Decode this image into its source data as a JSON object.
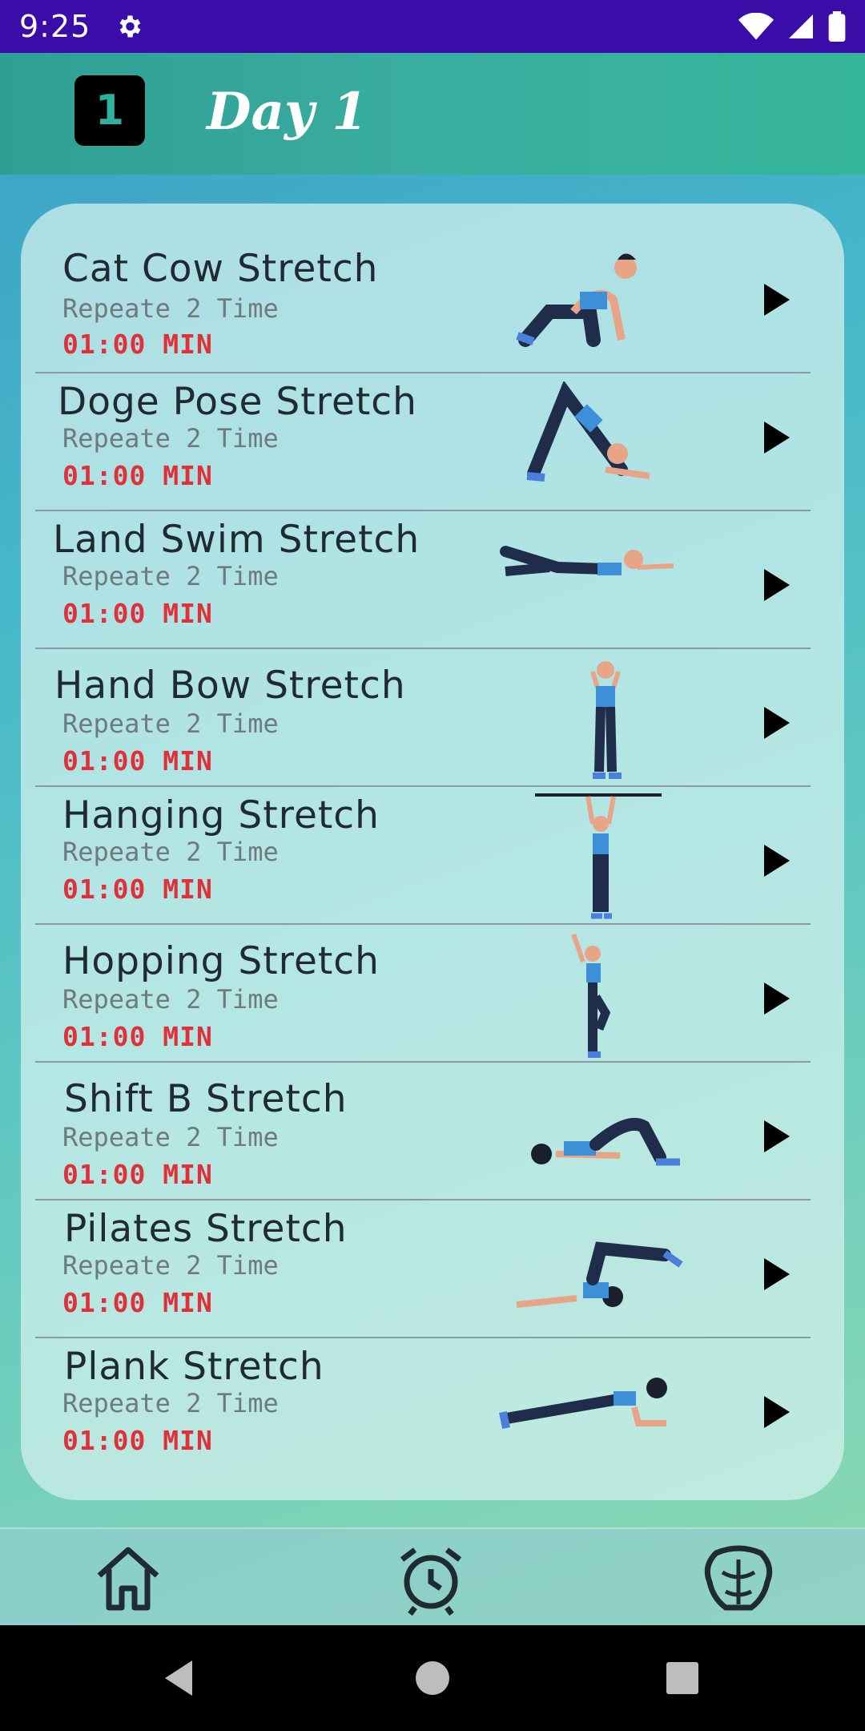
{
  "status_bar": {
    "time": "9:25"
  },
  "header": {
    "badge": "1",
    "title": "Day 1"
  },
  "exercises": [
    {
      "name": "Cat Cow Stretch",
      "repeat": "Repeate 2 Time",
      "time": "01:00 MIN"
    },
    {
      "name": "Doge Pose Stretch",
      "repeat": "Repeate 2 Time",
      "time": "01:00 MIN"
    },
    {
      "name": "Land Swim Stretch",
      "repeat": "Repeate 2 Time",
      "time": "01:00 MIN"
    },
    {
      "name": "Hand Bow Stretch",
      "repeat": "Repeate 2 Time",
      "time": "01:00 MIN"
    },
    {
      "name": "Hanging Stretch",
      "repeat": "Repeate 2 Time",
      "time": "01:00 MIN"
    },
    {
      "name": "Hopping Stretch",
      "repeat": "Repeate 2 Time",
      "time": "01:00 MIN"
    },
    {
      "name": "Shift B Stretch",
      "repeat": "Repeate 2 Time",
      "time": "01:00 MIN"
    },
    {
      "name": "Pilates Stretch",
      "repeat": "Repeate 2 Time",
      "time": "01:00 MIN"
    },
    {
      "name": "Plank Stretch",
      "repeat": "Repeate 2 Time",
      "time": "01:00 MIN"
    }
  ],
  "colors": {
    "status_bar": "#3a0ca8",
    "time_text": "#e0303a",
    "header_teal": "#2f9f93"
  },
  "nav": {
    "items": [
      "home-icon",
      "alarm-clock-icon",
      "muscle-body-icon"
    ]
  }
}
